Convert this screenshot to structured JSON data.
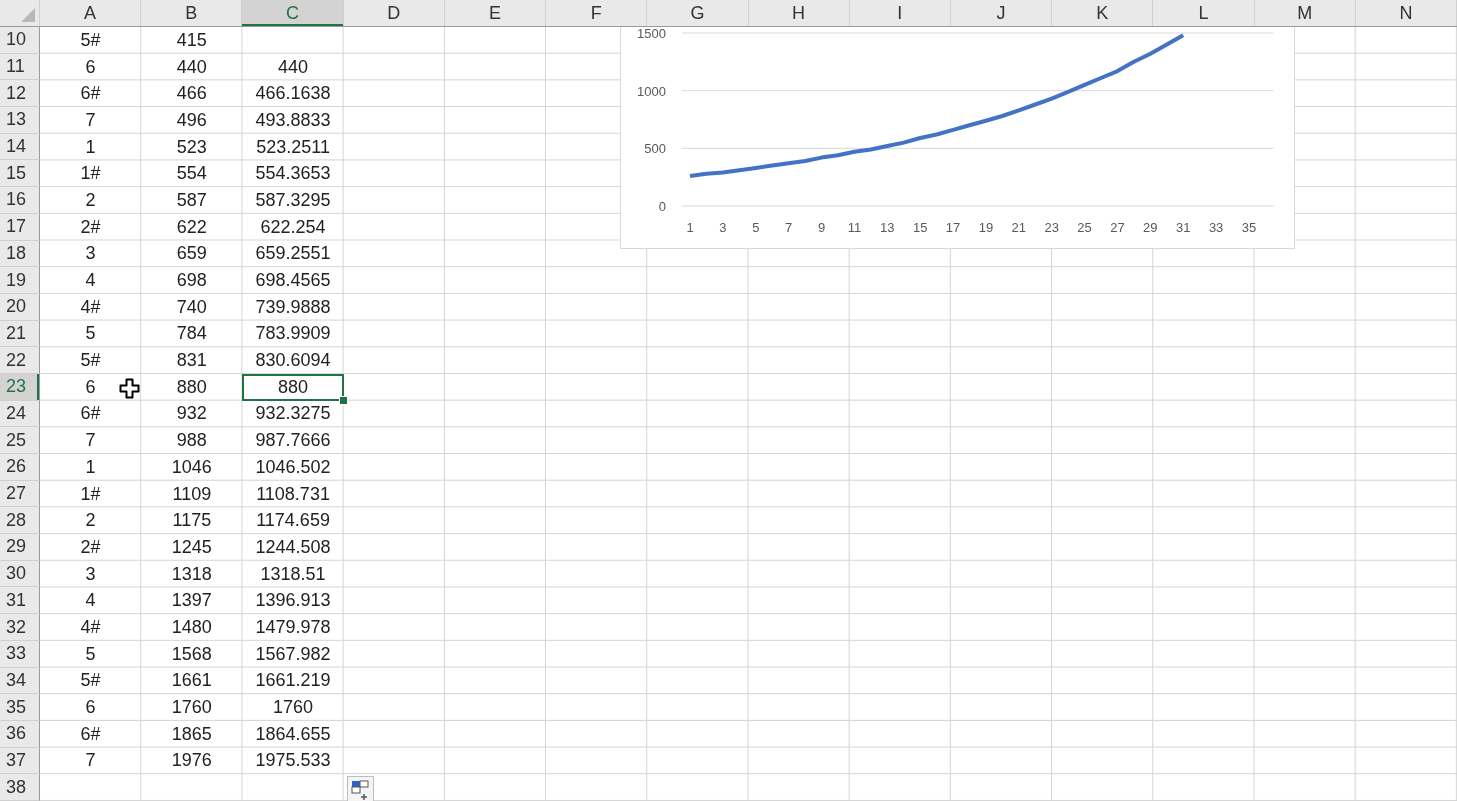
{
  "columns": [
    {
      "label": "A",
      "selected": false
    },
    {
      "label": "B",
      "selected": false
    },
    {
      "label": "C",
      "selected": true
    },
    {
      "label": "D",
      "selected": false
    },
    {
      "label": "E",
      "selected": false
    },
    {
      "label": "F",
      "selected": false
    },
    {
      "label": "G",
      "selected": false
    },
    {
      "label": "H",
      "selected": false
    },
    {
      "label": "I",
      "selected": false
    },
    {
      "label": "J",
      "selected": false
    },
    {
      "label": "K",
      "selected": false
    },
    {
      "label": "L",
      "selected": false
    },
    {
      "label": "M",
      "selected": false
    },
    {
      "label": "N",
      "selected": false
    }
  ],
  "rows": [
    {
      "number": "10",
      "selected": false,
      "cells": [
        "5#",
        "415"
      ]
    },
    {
      "number": "11",
      "selected": false,
      "cells": [
        "6",
        "440",
        "440"
      ]
    },
    {
      "number": "12",
      "selected": false,
      "cells": [
        "6#",
        "466",
        "466.1638"
      ]
    },
    {
      "number": "13",
      "selected": false,
      "cells": [
        "7",
        "496",
        "493.8833"
      ]
    },
    {
      "number": "14",
      "selected": false,
      "cells": [
        "1",
        "523",
        "523.2511"
      ]
    },
    {
      "number": "15",
      "selected": false,
      "cells": [
        "1#",
        "554",
        "554.3653"
      ]
    },
    {
      "number": "16",
      "selected": false,
      "cells": [
        "2",
        "587",
        "587.3295"
      ]
    },
    {
      "number": "17",
      "selected": false,
      "cells": [
        "2#",
        "622",
        "622.254"
      ]
    },
    {
      "number": "18",
      "selected": false,
      "cells": [
        "3",
        "659",
        "659.2551"
      ]
    },
    {
      "number": "19",
      "selected": false,
      "cells": [
        "4",
        "698",
        "698.4565"
      ]
    },
    {
      "number": "20",
      "selected": false,
      "cells": [
        "4#",
        "740",
        "739.9888"
      ]
    },
    {
      "number": "21",
      "selected": false,
      "cells": [
        "5",
        "784",
        "783.9909"
      ]
    },
    {
      "number": "22",
      "selected": false,
      "cells": [
        "5#",
        "831",
        "830.6094"
      ]
    },
    {
      "number": "23",
      "selected": true,
      "cells": [
        "6",
        "880",
        "880"
      ]
    },
    {
      "number": "24",
      "selected": false,
      "cells": [
        "6#",
        "932",
        "932.3275"
      ]
    },
    {
      "number": "25",
      "selected": false,
      "cells": [
        "7",
        "988",
        "987.7666"
      ]
    },
    {
      "number": "26",
      "selected": false,
      "cells": [
        "1",
        "1046",
        "1046.502"
      ]
    },
    {
      "number": "27",
      "selected": false,
      "cells": [
        "1#",
        "1109",
        "1108.731"
      ]
    },
    {
      "number": "28",
      "selected": false,
      "cells": [
        "2",
        "1175",
        "1174.659"
      ]
    },
    {
      "number": "29",
      "selected": false,
      "cells": [
        "2#",
        "1245",
        "1244.508"
      ]
    },
    {
      "number": "30",
      "selected": false,
      "cells": [
        "3",
        "1318",
        "1318.51"
      ]
    },
    {
      "number": "31",
      "selected": false,
      "cells": [
        "4",
        "1397",
        "1396.913"
      ]
    },
    {
      "number": "32",
      "selected": false,
      "cells": [
        "4#",
        "1480",
        "1479.978"
      ]
    },
    {
      "number": "33",
      "selected": false,
      "cells": [
        "5",
        "1568",
        "1567.982"
      ]
    },
    {
      "number": "34",
      "selected": false,
      "cells": [
        "5#",
        "1661",
        "1661.219"
      ]
    },
    {
      "number": "35",
      "selected": false,
      "cells": [
        "6",
        "1760",
        "1760"
      ]
    },
    {
      "number": "36",
      "selected": false,
      "cells": [
        "6#",
        "1865",
        "1864.655"
      ]
    },
    {
      "number": "37",
      "selected": false,
      "cells": [
        "7",
        "1976",
        "1975.533"
      ]
    },
    {
      "number": "38",
      "selected": false
    }
  ],
  "chart": {
    "chart_data": {
      "type": "line",
      "x": [
        1,
        2,
        3,
        4,
        5,
        6,
        7,
        8,
        9,
        10,
        11,
        12,
        13,
        14,
        15,
        16,
        17,
        18,
        19,
        20,
        21,
        22,
        23,
        24,
        25,
        26,
        27,
        28,
        29,
        30,
        31
      ],
      "xlim": [
        0.5,
        36.5
      ],
      "xticks": [
        1,
        3,
        5,
        7,
        9,
        11,
        13,
        15,
        17,
        19,
        21,
        23,
        25,
        27,
        29,
        31,
        33,
        35
      ],
      "ylim": [
        0,
        1500
      ],
      "grid": true,
      "yticks": [
        0,
        500,
        1000,
        1500
      ],
      "series": [
        {
          "color": "#4472c4",
          "values": [
            260,
            280,
            290,
            310,
            330,
            350,
            370,
            390,
            420,
            440,
            470,
            490,
            520,
            550,
            590,
            620,
            660,
            700,
            740,
            780,
            830,
            880,
            930,
            990,
            1050,
            1110,
            1170,
            1250,
            1320,
            1400,
            1480
          ]
        }
      ]
    }
  }
}
